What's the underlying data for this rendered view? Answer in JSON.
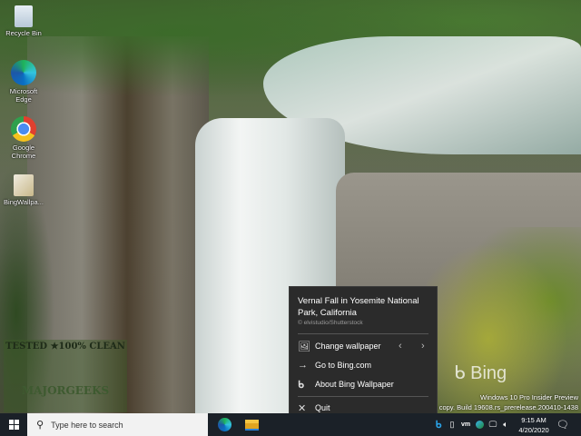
{
  "desktop": {
    "icons": [
      {
        "label": "Recycle Bin",
        "icon": "recycle-bin-icon"
      },
      {
        "label": "Microsoft Edge",
        "icon": "edge-icon"
      },
      {
        "label": "Google Chrome",
        "icon": "chrome-icon"
      },
      {
        "label": "BingWallpa...",
        "icon": "bing-wallpaper-app-icon"
      }
    ],
    "watermark_logo": "TESTED ★100% CLEAN MAJORGEEKS .COM",
    "bing_logo": "Bing",
    "os_watermark": {
      "line1": "Windows 10 Pro Insider Preview",
      "line2": "or copy. Build 19608.rs_prerelease.200410-1438"
    }
  },
  "menu": {
    "title": "Vernal Fall in Yosemite National Park, California",
    "credit": "© elvistudio/Shutterstock",
    "items": [
      {
        "label": "Change wallpaper",
        "icon": "image-icon"
      },
      {
        "label": "Go to Bing.com",
        "icon": "arrow-right-icon"
      },
      {
        "label": "About Bing Wallpaper",
        "icon": "bing-icon"
      },
      {
        "label": "Quit",
        "icon": "close-icon"
      }
    ],
    "prev": "‹",
    "next": "›"
  },
  "taskbar": {
    "search_placeholder": "Type here to search",
    "time": "9:15 AM",
    "date": "4/20/2020"
  }
}
